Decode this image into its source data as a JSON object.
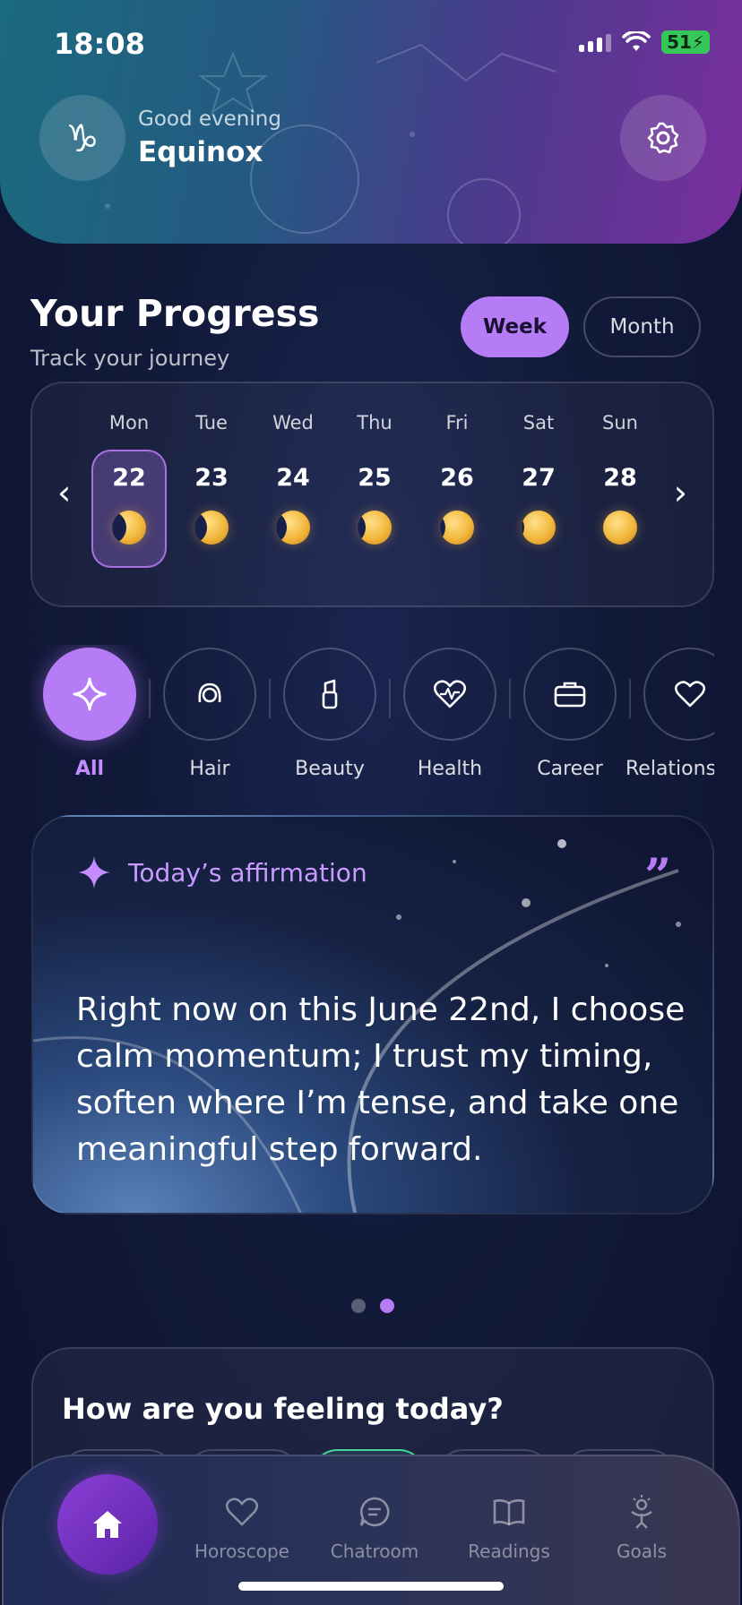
{
  "status": {
    "time": "18:08",
    "battery": "51"
  },
  "header": {
    "avatar_symbol": "♑",
    "greeting": "Good evening",
    "user_name": "Equinox"
  },
  "progress": {
    "title": "Your Progress",
    "subtitle": "Track your journey",
    "segments": {
      "week": "Week",
      "month": "Month",
      "selected": "week"
    },
    "prev_arrow": "‹",
    "next_arrow": "›",
    "days": [
      {
        "name": "Mon",
        "num": "22",
        "selected": true,
        "moon_phase": "waxing-crescent"
      },
      {
        "name": "Tue",
        "num": "23",
        "moon_phase": "waxing-crescent"
      },
      {
        "name": "Wed",
        "num": "24",
        "moon_phase": "waxing-crescent"
      },
      {
        "name": "Thu",
        "num": "25",
        "moon_phase": "waxing-gibbous"
      },
      {
        "name": "Fri",
        "num": "26",
        "moon_phase": "waxing-gibbous"
      },
      {
        "name": "Sat",
        "num": "27",
        "moon_phase": "nearly-full"
      },
      {
        "name": "Sun",
        "num": "28",
        "moon_phase": "full"
      }
    ]
  },
  "categories": [
    {
      "label": "All",
      "icon": "sparkle-icon",
      "active": true
    },
    {
      "label": "Hair",
      "icon": "hair-icon"
    },
    {
      "label": "Beauty",
      "icon": "lipstick-icon"
    },
    {
      "label": "Health",
      "icon": "heart-pulse-icon"
    },
    {
      "label": "Career",
      "icon": "briefcase-icon"
    },
    {
      "label": "Relationships",
      "icon": "heart-icon"
    }
  ],
  "affirmation": {
    "title": "Today’s affirmation",
    "quote_mark": "”",
    "text": "Right now on this June 22nd, I choose calm momentum; I trust my timing, soften where I’m tense, and take one meaningful step forward."
  },
  "carousel": {
    "pages": 2,
    "active": 2
  },
  "feelings": {
    "title": "How are you feeling today?"
  },
  "nav": {
    "items": [
      {
        "label": "Horoscope",
        "icon": "heart-crescent-icon"
      },
      {
        "label": "Chatroom",
        "icon": "chat-bubble-icon"
      },
      {
        "label": "Readings",
        "icon": "open-book-icon"
      },
      {
        "label": "Goals",
        "icon": "person-bulb-icon"
      }
    ]
  },
  "colors": {
    "accent": "#b67cf6",
    "mood_highlight": "#47d6a0"
  }
}
